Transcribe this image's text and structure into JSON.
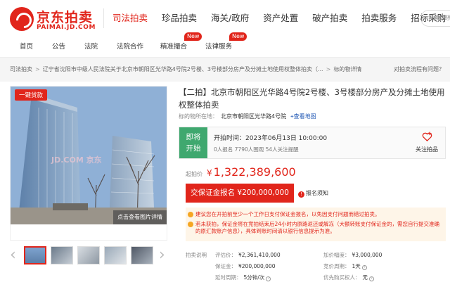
{
  "logo": {
    "cn": "京东拍卖",
    "en": "PAIMAI.JD.COM"
  },
  "main_nav": [
    {
      "label": "司法拍卖",
      "active": true
    },
    {
      "label": "珍品拍卖",
      "active": false
    },
    {
      "label": "海关/政府",
      "active": false
    },
    {
      "label": "资产处置",
      "active": false
    },
    {
      "label": "破产拍卖",
      "active": false
    },
    {
      "label": "拍卖服务",
      "active": false
    },
    {
      "label": "招标采购",
      "active": false
    }
  ],
  "search": {
    "placeholder": "搜索你想要的拍品"
  },
  "sub_nav": [
    {
      "label": "首页"
    },
    {
      "label": "公告"
    },
    {
      "label": "法院"
    },
    {
      "label": "法院合作"
    },
    {
      "label": "精准撮合",
      "badge": "New"
    },
    {
      "label": "法律服务",
      "badge": "New"
    }
  ],
  "breadcrumb": {
    "items": [
      "司法拍卖",
      "辽宁省沈阳市中级人民法院关于北京市朝阳区光华路4号院2号楼、3号楼部分房产及分摊土地使用权整体拍卖（...",
      "标的物详情"
    ],
    "right": "对拍卖流程有问题？"
  },
  "gallery": {
    "loan_tag": "一键贷款",
    "watermark": "JD.COM 京东",
    "view_button": "点击查看图片详情",
    "prev_icon": "chevron-left-icon",
    "next_icon": "chevron-right-icon"
  },
  "item": {
    "title": "【二拍】北京市朝阳区光华路4号院2号楼、3号楼部分房产及分摊土地使用权整体拍卖",
    "location_label": "标的物所在地：",
    "location_value": "北京市朝阳区光华路4号院",
    "map_link": "查看地图"
  },
  "status": {
    "line1": "即将",
    "line2": "开始",
    "start_label": "开拍时间：",
    "start_time": "2023年06月13日 10:00:00",
    "counts": "0人报名   7790人围观   54人关注提醒",
    "fav_label": "关注拍品"
  },
  "price": {
    "label": "起拍价",
    "currency": "¥",
    "value": "1,322,389,600"
  },
  "deposit_button": "交保证金报名 ¥200,000,000",
  "notice": {
    "icon": "!",
    "label": "报名须知"
  },
  "tips": [
    "建议您在开拍前至少一个工作日支付保证金报名，以免因支付问题而错过拍卖。",
    "若未获拍，保证金将在竞拍结束后24小时内原路返还或解冻（大额转账支付保证金的，需您自行提交准确的原汇款账户信息），具体到账时间请以银行信息提示为准。"
  ],
  "info": {
    "section": "拍卖说明",
    "items": [
      {
        "label": "评估价：",
        "value": "¥2,361,410,000",
        "help": false
      },
      {
        "label": "加价幅度：",
        "value": "¥3,000,000",
        "help": false
      },
      {
        "label": "保证金：",
        "value": "¥200,000,000",
        "help": false
      },
      {
        "label": "竞价周期：",
        "value": "1天",
        "help": true
      },
      {
        "label": "延时周期：",
        "value": "5分钟/次",
        "help": true
      },
      {
        "label": "优先购买权人：",
        "value": "无",
        "help": true
      }
    ]
  },
  "colors": {
    "brand": "#e1251b",
    "status_green": "#3fa86f",
    "link": "#1f57b4",
    "tip_bg": "#fef5e8"
  }
}
